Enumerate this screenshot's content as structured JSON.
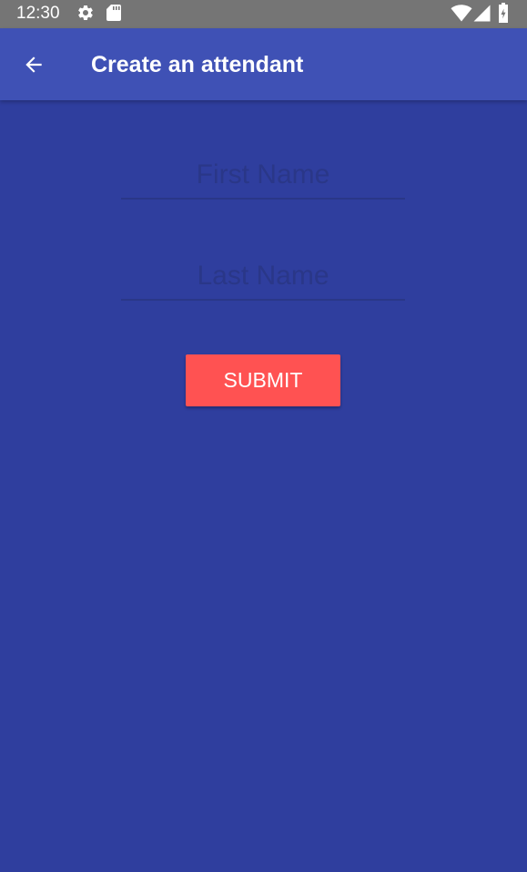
{
  "status_bar": {
    "time": "12:30",
    "icons": [
      "settings-icon",
      "sd-card-icon",
      "wifi-icon",
      "signal-icon",
      "battery-icon"
    ]
  },
  "app_bar": {
    "back_icon": "arrow-back-icon",
    "title": "Create an attendant"
  },
  "form": {
    "first_name": {
      "value": "",
      "placeholder": "First Name"
    },
    "last_name": {
      "value": "",
      "placeholder": "Last Name"
    },
    "submit_label": "SUBMIT"
  },
  "colors": {
    "status_bar": "#757575",
    "app_bar": "#3f51b5",
    "background": "#2f3e9e",
    "field_text": "#2a3788",
    "submit_button": "#ff5252",
    "on_primary": "#ffffff"
  }
}
